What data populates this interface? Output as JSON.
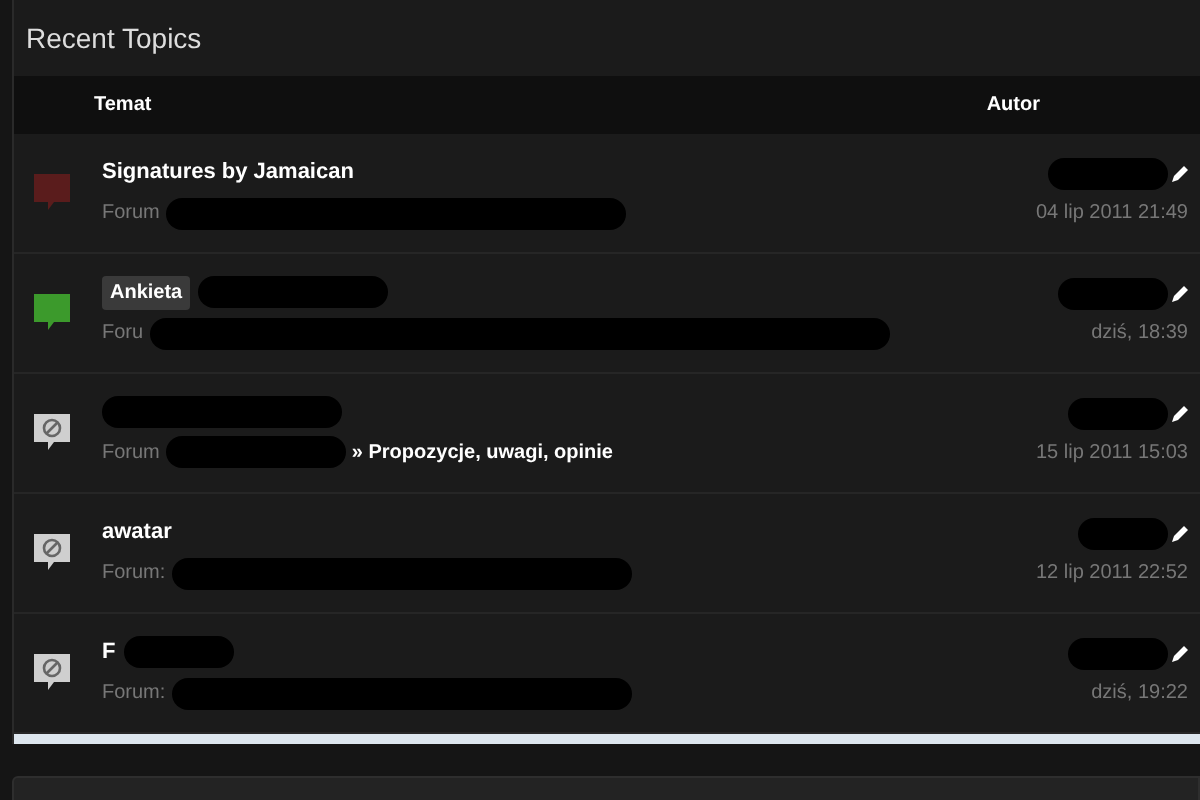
{
  "panel": {
    "title": "Recent Topics"
  },
  "columns": [
    "Temat",
    "Autor"
  ],
  "topics": [
    {
      "kind": "hot",
      "title": "Signatures by Jamaican",
      "forum": "Forum",
      "date": "04 lip 2011 21:49",
      "redacted": true
    },
    {
      "kind": "poll",
      "prefix_tag": "Ankieta",
      "forum": "Foru",
      "date": "dziś, 18:39",
      "redacted": true
    },
    {
      "kind": "locked",
      "forum": "Forum",
      "forum_link": "» Propozycje, uwagi, opinie",
      "date": "15 lip 2011 15:03",
      "redacted": true
    },
    {
      "kind": "locked",
      "title": "awatar",
      "forum": "Forum:",
      "date": "12 lip 2011 22:52",
      "redacted": true
    },
    {
      "kind": "locked",
      "title": "F",
      "forum": "Forum:",
      "date": "dziś, 19:22",
      "redacted": true
    }
  ]
}
